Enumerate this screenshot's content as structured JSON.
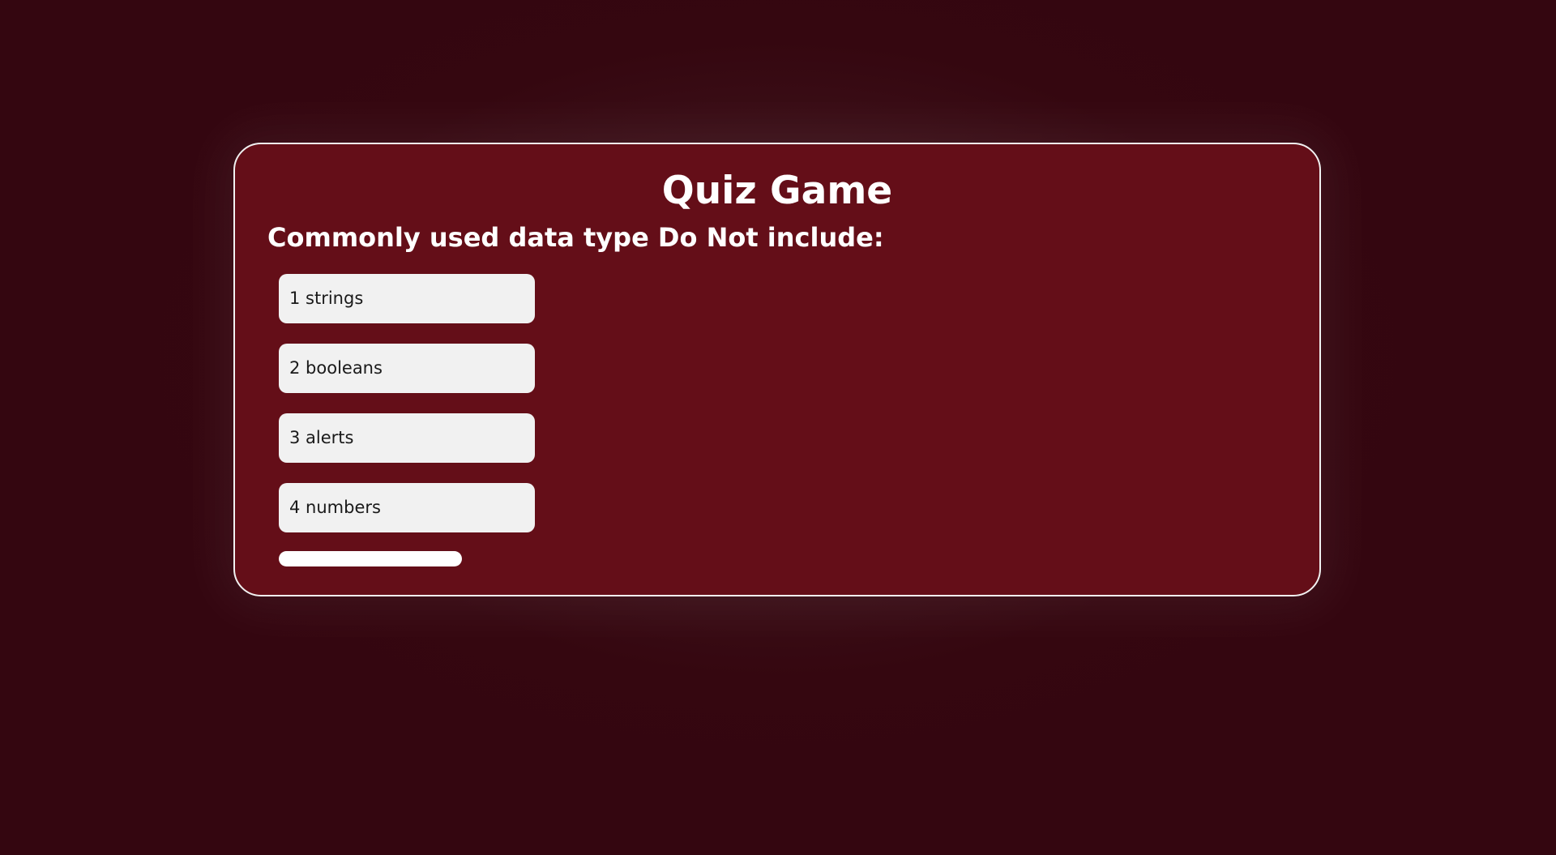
{
  "app": {
    "title": "Quiz Game"
  },
  "quiz": {
    "question": "Commonly used data type Do Not include:",
    "answers": [
      {
        "label": "1 strings"
      },
      {
        "label": "2 booleans"
      },
      {
        "label": "3 alerts"
      },
      {
        "label": "4 numbers"
      }
    ],
    "progress_fraction": 1.0
  },
  "colors": {
    "background": "#350710",
    "card": "#640e18",
    "card_border": "#f1f1f1",
    "answer_bg": "#f1f1f1",
    "text_light": "#ffffff",
    "text_dark": "#1a1a1a"
  }
}
